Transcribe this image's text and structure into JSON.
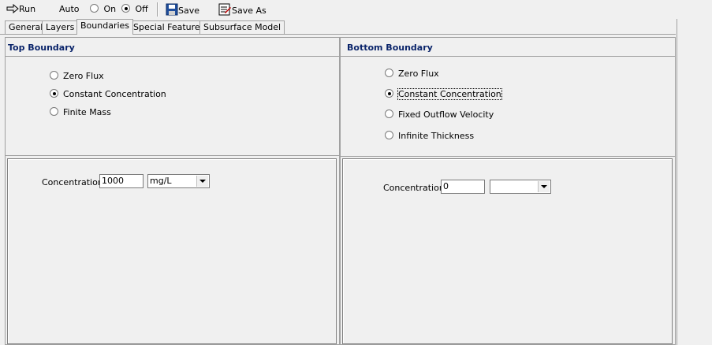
{
  "toolbar": {
    "run_label": "Run",
    "auto_label": "Auto",
    "on_label": "On",
    "off_label": "Off",
    "auto_mode": "off",
    "save_label": "Save",
    "save_as_label": "Save As"
  },
  "tabs": [
    {
      "label": "General",
      "active": false
    },
    {
      "label": "Layers",
      "active": false
    },
    {
      "label": "Boundaries",
      "active": true
    },
    {
      "label": "Special Features",
      "active": false
    },
    {
      "label": "Subsurface Model",
      "active": false
    }
  ],
  "top_boundary": {
    "title": "Top Boundary",
    "options": [
      {
        "label": "Zero Flux",
        "checked": false
      },
      {
        "label": "Constant Concentration",
        "checked": true
      },
      {
        "label": "Finite Mass",
        "checked": false
      }
    ],
    "concentration_label": "Concentration",
    "concentration_value": "1000",
    "unit_value": "mg/L"
  },
  "bottom_boundary": {
    "title": "Bottom Boundary",
    "options": [
      {
        "label": "Zero Flux",
        "checked": false
      },
      {
        "label": "Constant Concentration",
        "checked": true
      },
      {
        "label": "Fixed Outflow Velocity",
        "checked": false
      },
      {
        "label": "Infinite Thickness",
        "checked": false
      }
    ],
    "concentration_label": "Concentration",
    "concentration_value": "0",
    "unit_value": ""
  },
  "colors": {
    "title_text": "#0a246a",
    "background": "#f0f0f0",
    "border": "#a0a0a0"
  }
}
